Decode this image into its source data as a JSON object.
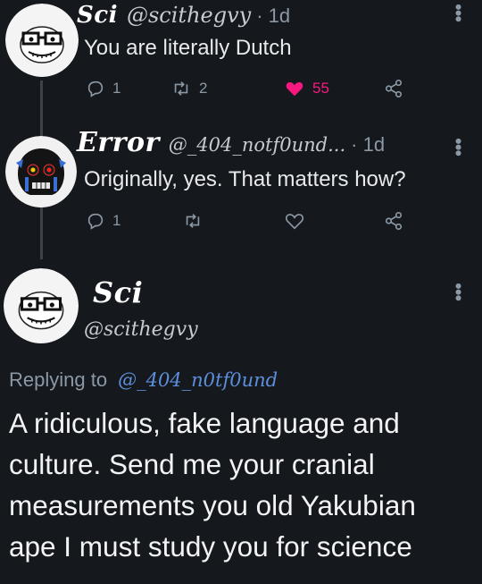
{
  "tweets": [
    {
      "author": "Sci",
      "handle": "@scithegvy",
      "time": "· 1d",
      "text": "You are literally Dutch",
      "replies": "1",
      "retweets": "2",
      "likes": "55",
      "liked": true
    },
    {
      "author": "Error",
      "handle": "@_404_notf0und...",
      "time": "· 1d",
      "text": "Originally, yes. That matters how?",
      "replies": "1",
      "retweets": "",
      "likes": "",
      "liked": false
    }
  ],
  "main_tweet": {
    "author": "Sci",
    "handle": "@scithegvy",
    "replying_label": "Replying to",
    "replying_to": "@_404_n0tf0und",
    "text_lines": [
      "A ridiculous, fake language and",
      "culture. Send me your cranial",
      "measurements you old Yakubian",
      "ape I must study you for science"
    ]
  },
  "colors": {
    "background": "#15181c",
    "like": "#f91880",
    "mention": "#5c8fdc",
    "muted": "#8b98a5"
  },
  "icons": [
    "reply-icon",
    "retweet-icon",
    "like-icon",
    "share-icon",
    "more-icon"
  ]
}
